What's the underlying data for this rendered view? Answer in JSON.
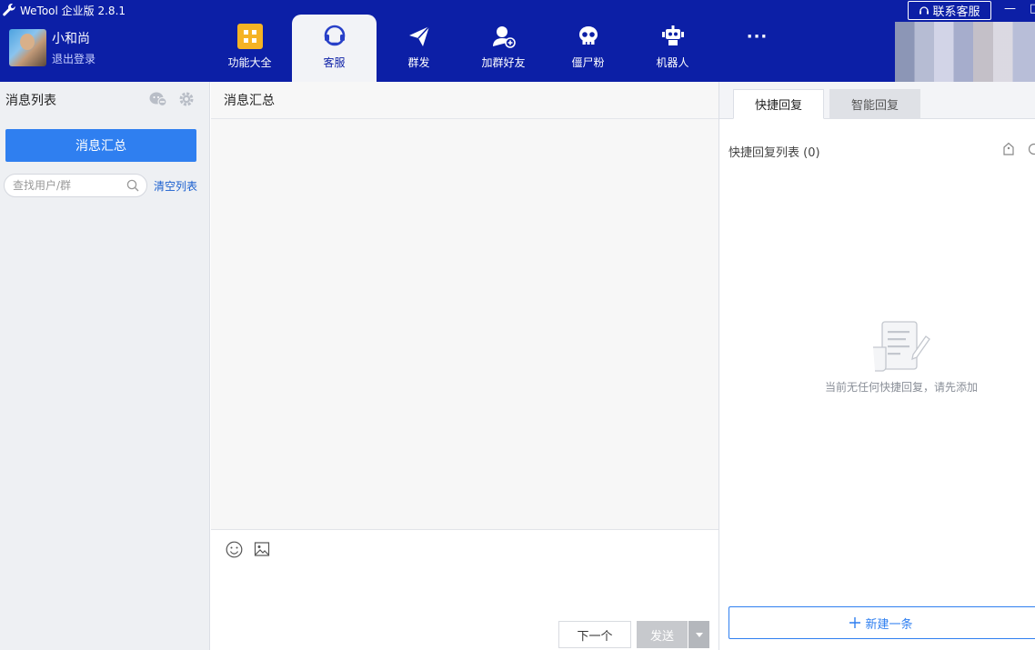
{
  "window": {
    "title": "WeTool 企业版 2.8.1",
    "contact_label": "联系客服",
    "minimize": "—",
    "restore": "□"
  },
  "user": {
    "name": "小和尚",
    "logout": "退出登录"
  },
  "nav": [
    {
      "label": "功能大全",
      "icon": "grid-icon"
    },
    {
      "label": "客服",
      "icon": "headset-icon",
      "active": true
    },
    {
      "label": "群发",
      "icon": "paper-plane-icon"
    },
    {
      "label": "加群好友",
      "icon": "add-user-icon"
    },
    {
      "label": "僵尸粉",
      "icon": "skull-icon"
    },
    {
      "label": "机器人",
      "icon": "robot-icon"
    },
    {
      "label": "···",
      "icon": "more-icon"
    }
  ],
  "left": {
    "title": "消息列表",
    "summary_button": "消息汇总",
    "search_placeholder": "查找用户/群",
    "clear_link": "清空列表"
  },
  "middle": {
    "title": "消息汇总",
    "next_button": "下一个",
    "send_button": "发送"
  },
  "right": {
    "tabs": [
      "快捷回复",
      "智能回复"
    ],
    "list_title": "快捷回复列表 (0)",
    "empty_text": "当前无任何快捷回复，请先添加",
    "new_button": "新建一条"
  },
  "colors": {
    "topbar": "#0c1fa6",
    "accent": "#2f7ff0",
    "feature_icon": "#f5b324"
  }
}
